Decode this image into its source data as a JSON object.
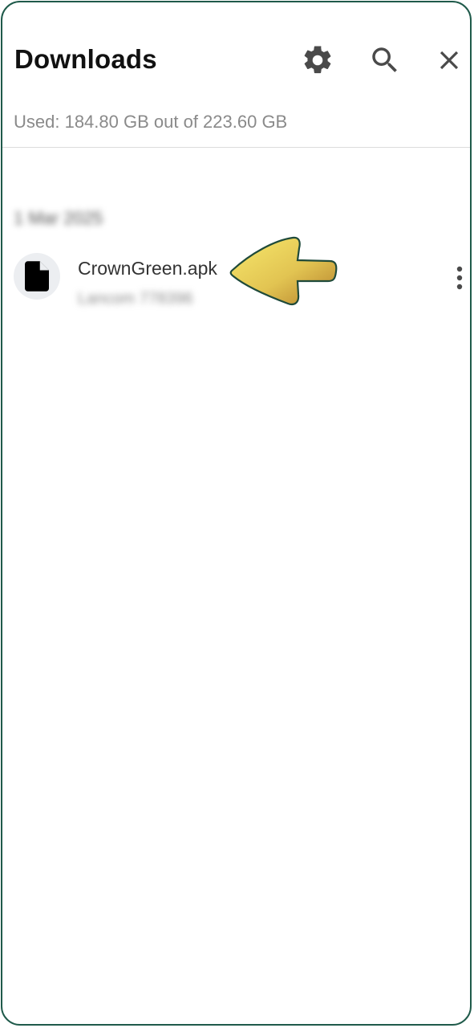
{
  "header": {
    "title": "Downloads",
    "icons": [
      "gear-icon",
      "search-icon",
      "close-icon"
    ]
  },
  "storage": {
    "text": "Used: 184.80 GB out of 223.60 GB"
  },
  "list": {
    "date_header": "1 Mar 2025",
    "items": [
      {
        "name": "CrownGreen.apk",
        "meta": "Lancom 778396",
        "icon": "file-icon"
      }
    ]
  },
  "colors": {
    "frame_border": "#1f5a4a",
    "title": "#111111",
    "icon": "#4a4a4a",
    "secondary_text": "#8a8a8a",
    "divider": "#dcdcdc",
    "arrow_fill_light": "#f4e36a",
    "arrow_fill_dark": "#b8852e",
    "arrow_stroke": "#1f4a3a"
  }
}
